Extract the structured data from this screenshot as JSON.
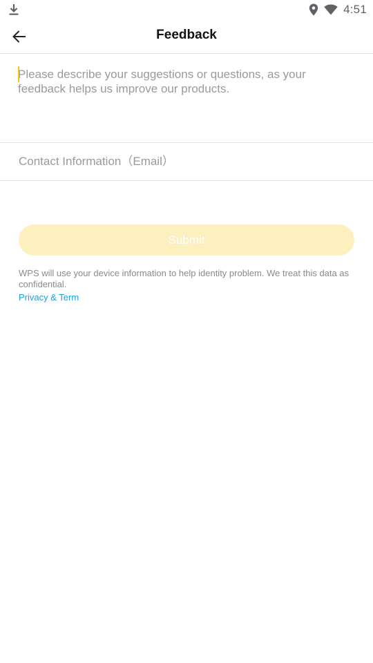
{
  "status_bar": {
    "time": "4:51",
    "icons": [
      "download-icon",
      "location-icon",
      "wifi-icon"
    ]
  },
  "header": {
    "title": "Feedback",
    "back_icon": "back-arrow-icon"
  },
  "feedback": {
    "placeholder": "Please describe your suggestions or questions, as your feedback helps us improve our products.",
    "value": ""
  },
  "contact": {
    "placeholder": "Contact Information（Email）",
    "value": ""
  },
  "submit": {
    "label": "Submit",
    "enabled": false
  },
  "disclaimer": {
    "text": "WPS will use your device information to help identity problem. We treat this data as confidential.",
    "link_label": "Privacy & Term"
  },
  "colors": {
    "accent": "#f0c419",
    "submit_disabled_bg": "#fdf0bf",
    "link": "#1a9ee0",
    "divider": "#e3e3e3",
    "placeholder": "#9a9a9a"
  }
}
